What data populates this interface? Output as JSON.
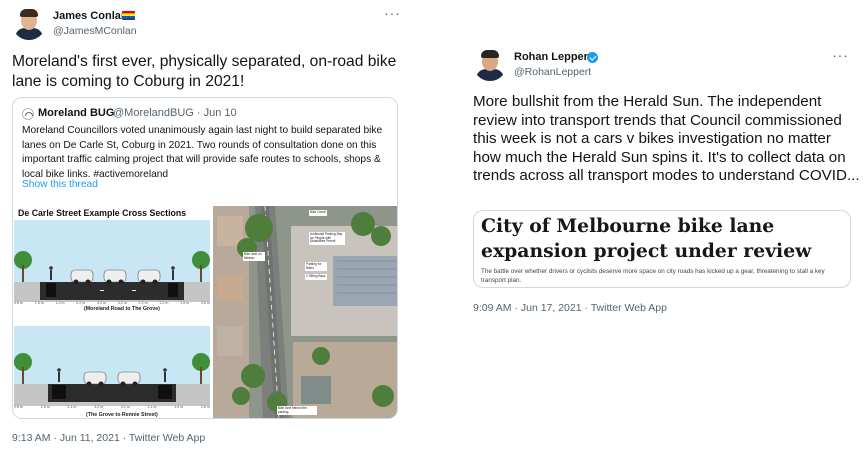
{
  "left_tweet": {
    "author_name": "James Conlan",
    "author_handle": "@JamesMConlan",
    "flag_icon": "rainbow-flag-emoji",
    "text": "Moreland's first ever, physically separated, on-road bike lane is coming to Coburg in 2021!",
    "timestamp": "9:13 AM · Jun 11, 2021 · Twitter Web App",
    "quoted": {
      "author_name": "Moreland BUG",
      "author_meta": "@MorelandBUG · Jun 10",
      "text": "Moreland Councillors voted unanimously again last night to build separated bike lanes on De Carle St, Coburg in 2021. Two rounds of consultation done on this important traffic calming project that will provide safe routes to schools, shops & local bike links.  #activemoreland",
      "show_thread": "Show this thread",
      "diagram": {
        "title": "De Carle Street Example Cross Sections",
        "section1_caption": "(Moreland Road to The Grove)",
        "section2_caption": "(The Grove to Rennie Street)",
        "section1_dims": [
          "3.6 m",
          "1.5 m",
          "1.0 m",
          "2.2 m",
          "3.2 m",
          "3.2 m",
          "2.2 m",
          "1.0 m",
          "1.5 m",
          "3.6 m"
        ],
        "section2_dims": [
          "2.6 m",
          "1.5 m",
          "2.1 m",
          "3.2 m",
          "3.2 m",
          "2.1 m",
          "1.5 m",
          "2.6 m"
        ]
      },
      "map": {
        "notes": [
          "Bike Corral",
          "Additional Parking Bay for People with Disabilities Permit",
          "Bike lane on Median",
          "Parking for Bikes",
          "2 Sitting Bays",
          "Bike lane behind the parking"
        ]
      }
    }
  },
  "right_tweet": {
    "author_name": "Rohan Leppert",
    "author_handle": "@RohanLeppert",
    "verified_icon": "verified-badge-icon",
    "text": "More bullshit from the Herald Sun. The independent review into transport trends that Council commissioned this week is not a cars v bikes investigation no matter how much the Herald Sun spins it. It's to collect data on trends across all transport modes to understand COVID...",
    "timestamp": "9:09 AM · Jun 17, 2021 · Twitter Web App",
    "article": {
      "title": "City of Melbourne bike lane expansion project under review",
      "description": "The battle over whether drivers or cyclists deserve more space on city roads has kicked up a gear, threatening to stall a key transport plan."
    }
  },
  "colors": {
    "link": "#1d9bf0",
    "secondary_text": "#536471",
    "border": "#cfd9de"
  }
}
